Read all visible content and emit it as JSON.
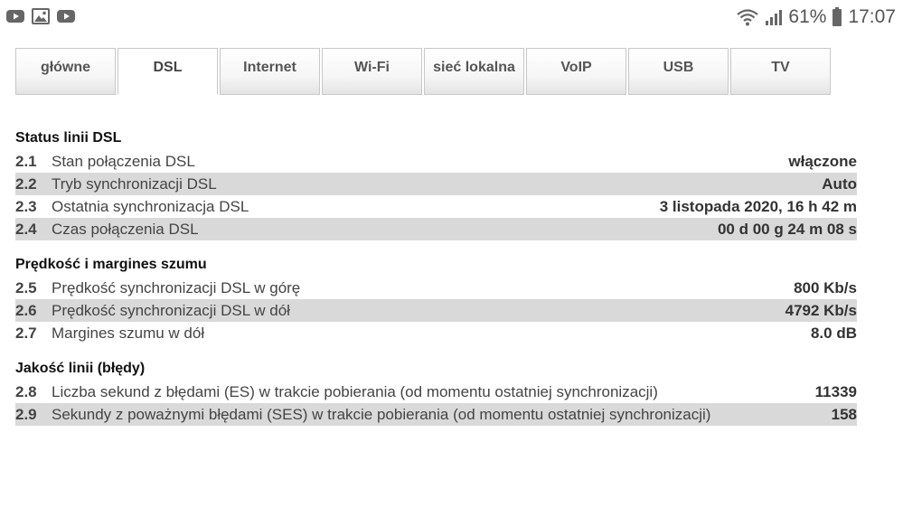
{
  "statusbar": {
    "left_icons": [
      "youtube-icon",
      "gallery-icon",
      "youtube-icon"
    ],
    "battery_percent": "61%",
    "time": "17:07"
  },
  "tabs": [
    {
      "label": "główne"
    },
    {
      "label": "DSL",
      "active": true
    },
    {
      "label": "Internet"
    },
    {
      "label": "Wi-Fi"
    },
    {
      "label": "sieć lokalna"
    },
    {
      "label": "VoIP"
    },
    {
      "label": "USB"
    },
    {
      "label": "TV"
    }
  ],
  "sections": [
    {
      "title": "Status linii DSL",
      "rows": [
        {
          "num": "2.1",
          "label": "Stan połączenia DSL",
          "value": "włączone"
        },
        {
          "num": "2.2",
          "label": "Tryb synchronizacji DSL",
          "value": "Auto"
        },
        {
          "num": "2.3",
          "label": "Ostatnia synchronizacja DSL",
          "value": "3 listopada 2020, 16 h 42 m"
        },
        {
          "num": "2.4",
          "label": "Czas połączenia DSL",
          "value": "00 d 00 g 24 m 08 s"
        }
      ]
    },
    {
      "title": "Prędkość i margines szumu",
      "rows": [
        {
          "num": "2.5",
          "label": "Prędkość synchronizacji DSL w górę",
          "value": "800 Kb/s"
        },
        {
          "num": "2.6",
          "label": "Prędkość synchronizacji DSL w dół",
          "value": "4792 Kb/s"
        },
        {
          "num": "2.7",
          "label": "Margines szumu w dół",
          "value": "8.0 dB"
        }
      ]
    },
    {
      "title": "Jakość linii (błędy)",
      "rows": [
        {
          "num": "2.8",
          "label": "Liczba sekund z błędami (ES) w trakcie pobierania (od momentu ostatniej synchronizacji)",
          "value": "11339"
        },
        {
          "num": "2.9",
          "label": "Sekundy z poważnymi błędami (SES) w trakcie pobierania (od momentu ostatniej synchronizacji)",
          "value": "158"
        }
      ]
    }
  ]
}
